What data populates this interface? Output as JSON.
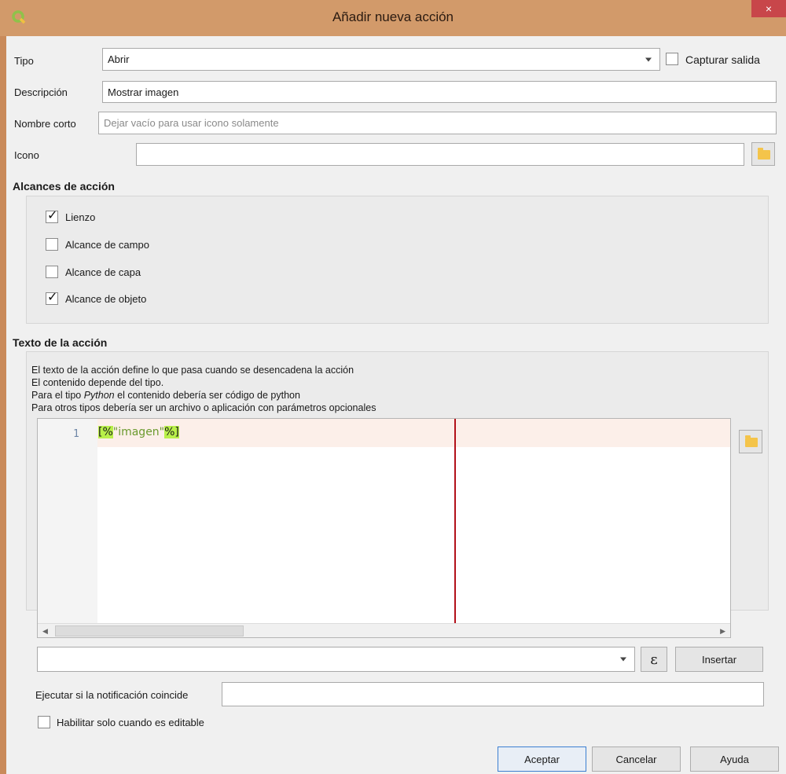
{
  "window": {
    "title": "Añadir nueva acción",
    "close_glyph": "×",
    "accent": "#d29a6a"
  },
  "form": {
    "tipo": {
      "label": "Tipo",
      "value": "Abrir"
    },
    "capture": {
      "label": "Capturar salida",
      "checked": false
    },
    "descripcion": {
      "label": "Descripción",
      "value": "Mostrar imagen"
    },
    "nombre_corto": {
      "label": "Nombre corto",
      "placeholder": "Dejar vacío para usar icono solamente"
    },
    "icono": {
      "label": "Icono",
      "value": ""
    }
  },
  "scopes": {
    "title": "Alcances de acción",
    "items": [
      {
        "label": "Lienzo",
        "checked": true
      },
      {
        "label": "Alcance de campo",
        "checked": false
      },
      {
        "label": "Alcance de capa",
        "checked": false
      },
      {
        "label": "Alcance de objeto",
        "checked": true
      }
    ]
  },
  "action_text": {
    "title": "Texto de la acción",
    "help_lines": [
      "El texto de la acción define lo que pasa cuando se desencadena la acción",
      "El contenido depende del tipo.",
      "Para otros tipos debería ser un archivo o aplicación con parámetros opcionales"
    ],
    "python_line": {
      "prefix": "Para el tipo ",
      "em": "Python",
      "suffix": " el contenido debería ser código de python"
    },
    "editor": {
      "line_number": "1",
      "code_open": "[%",
      "code_string": "\"imagen\"",
      "code_close": "%]"
    }
  },
  "insert_row": {
    "expression_glyph": "ε",
    "insert_label": "Insertar"
  },
  "notification": {
    "label": "Ejecutar si la notificación coincide",
    "value": ""
  },
  "editable_only": {
    "label": "Habilitar solo cuando es editable",
    "checked": false
  },
  "buttons": {
    "accept": "Aceptar",
    "cancel": "Cancelar",
    "help": "Ayuda"
  },
  "icons": [
    "qgis-logo-icon",
    "close-icon",
    "folder-icon",
    "chevron-down-icon",
    "expression-icon",
    "scroll-left-icon",
    "scroll-right-icon"
  ]
}
